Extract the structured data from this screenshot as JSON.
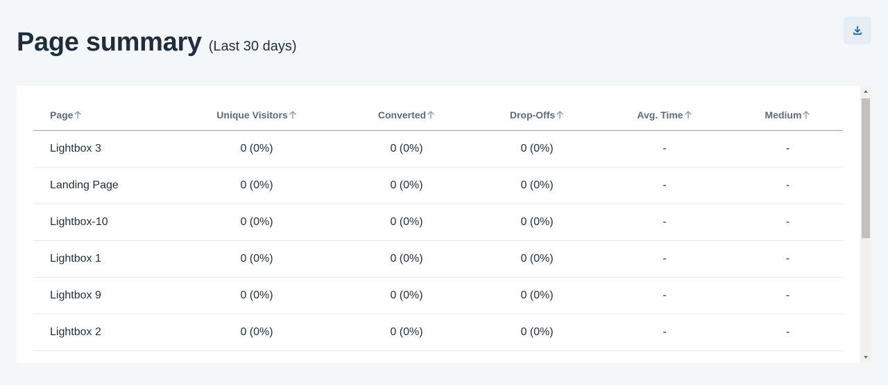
{
  "header": {
    "title": "Page summary",
    "subtitle": "(Last 30 days)"
  },
  "icons": {
    "download": "download-icon",
    "sort": "arrow-up-icon"
  },
  "colors": {
    "accent": "#1565c0",
    "header_text": "#5b6b7c"
  },
  "table": {
    "columns": [
      "Page",
      "Unique Visitors",
      "Converted",
      "Drop-Offs",
      "Avg. Time",
      "Medium"
    ],
    "rows": [
      [
        "Lightbox 3",
        "0 (0%)",
        "0 (0%)",
        "0 (0%)",
        "-",
        "-"
      ],
      [
        "Landing Page",
        "0 (0%)",
        "0 (0%)",
        "0 (0%)",
        "-",
        "-"
      ],
      [
        "Lightbox-10",
        "0 (0%)",
        "0 (0%)",
        "0 (0%)",
        "-",
        "-"
      ],
      [
        "Lightbox 1",
        "0 (0%)",
        "0 (0%)",
        "0 (0%)",
        "-",
        "-"
      ],
      [
        "Lightbox 9",
        "0 (0%)",
        "0 (0%)",
        "0 (0%)",
        "-",
        "-"
      ],
      [
        "Lightbox 2",
        "0 (0%)",
        "0 (0%)",
        "0 (0%)",
        "-",
        "-"
      ],
      [
        "",
        "",
        "",
        "",
        "",
        ""
      ]
    ]
  }
}
